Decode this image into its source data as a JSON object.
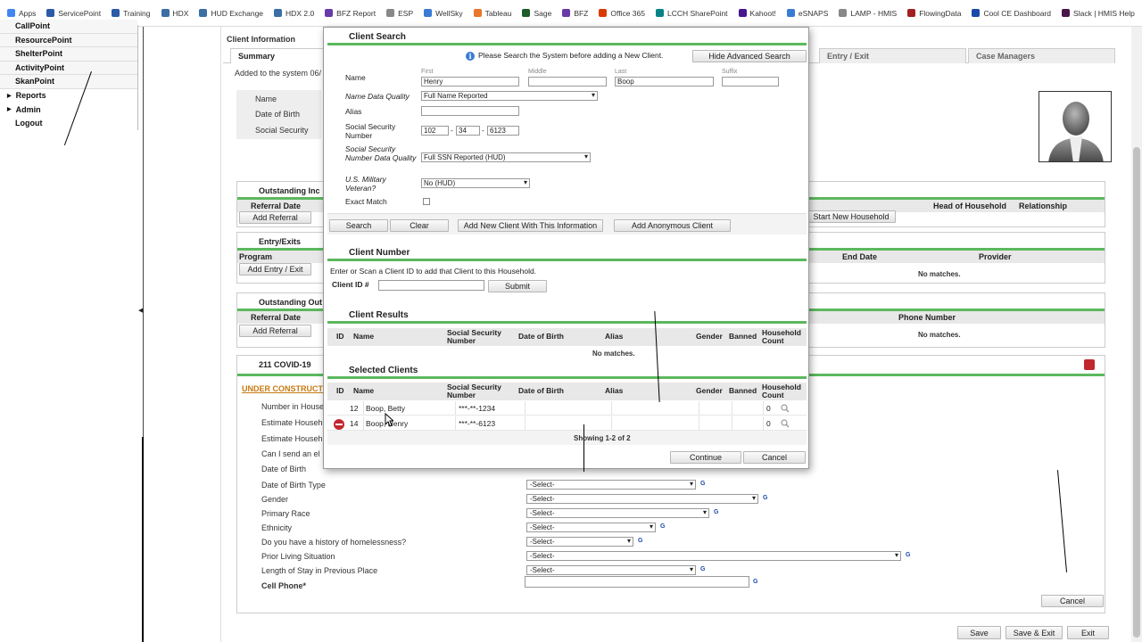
{
  "bookmarks": [
    {
      "label": "Apps",
      "icon": "apps-grid-icon",
      "color": "#4285f4"
    },
    {
      "label": "ServicePoint",
      "icon": "servicepoint-icon",
      "color": "#2b5aa8"
    },
    {
      "label": "Training",
      "icon": "servicepoint-icon",
      "color": "#2b5aa8"
    },
    {
      "label": "HDX",
      "icon": "hdx-icon",
      "color": "#3a6ea5"
    },
    {
      "label": "HUD Exchange",
      "icon": "hud-icon",
      "color": "#3a6ea5"
    },
    {
      "label": "HDX 2.0",
      "icon": "hdx-icon",
      "color": "#3a6ea5"
    },
    {
      "label": "BFZ Report",
      "icon": "bfz-icon",
      "color": "#6a3aa8"
    },
    {
      "label": "ESP",
      "icon": "esp-icon",
      "color": "#888888"
    },
    {
      "label": "WellSky",
      "icon": "wellsky-icon",
      "color": "#3a7bd5"
    },
    {
      "label": "Tableau",
      "icon": "tableau-icon",
      "color": "#e8762b"
    },
    {
      "label": "Sage",
      "icon": "sage-icon",
      "color": "#1e5a2a"
    },
    {
      "label": "BFZ",
      "icon": "bfz-icon",
      "color": "#6a3aa8"
    },
    {
      "label": "Office 365",
      "icon": "office-icon",
      "color": "#d83b01"
    },
    {
      "label": "LCCH SharePoint",
      "icon": "sharepoint-icon",
      "color": "#038387"
    },
    {
      "label": "Kahoot!",
      "icon": "kahoot-icon",
      "color": "#46178f"
    },
    {
      "label": "eSNAPS",
      "icon": "esnaps-icon",
      "color": "#3a7bd5"
    },
    {
      "label": "LAMP - HMIS",
      "icon": "lamp-icon",
      "color": "#888888"
    },
    {
      "label": "FlowingData",
      "icon": "flowingdata-icon",
      "color": "#a32020"
    },
    {
      "label": "Cool CE Dashboard",
      "icon": "dashboard-icon",
      "color": "#1a4aa8"
    },
    {
      "label": "Slack | HMIS Help",
      "icon": "slack-icon",
      "color": "#4a154b"
    }
  ],
  "bookmarks_more": "»",
  "leftnav": {
    "items": [
      {
        "label": "CallPoint",
        "expandable": false
      },
      {
        "label": "ResourcePoint",
        "expandable": false
      },
      {
        "label": "ShelterPoint",
        "expandable": false
      },
      {
        "label": "ActivityPoint",
        "expandable": false
      },
      {
        "label": "SkanPoint",
        "expandable": false
      },
      {
        "label": "Reports",
        "expandable": true
      },
      {
        "label": "Admin",
        "expandable": true
      },
      {
        "label": "Logout",
        "expandable": false
      }
    ]
  },
  "background": {
    "header": "Client Information",
    "tabs": [
      "Summary",
      "Entry / Exit",
      "Case Managers"
    ],
    "added_text": "Added to the system 06/",
    "summary_labels": [
      "Name",
      "Date of Birth",
      "Social Security"
    ],
    "outstanding_incoming": {
      "title": "Outstanding Inc",
      "col": "Referral Date",
      "button": "Add Referral",
      "start_button": "Start New Household",
      "col_head": "Head of Household",
      "col_rel": "Relationship"
    },
    "entry_exits": {
      "title": "Entry/Exits",
      "col": "Program",
      "button": "Add Entry / Exit",
      "col_end": "End Date",
      "col_provider": "Provider",
      "nomatch": "No matches."
    },
    "outstanding_outgoing": {
      "title": "Outstanding Out",
      "col": "Referral Date",
      "button": "Add Referral",
      "col_phone": "Phone Number",
      "nomatch": "No matches."
    },
    "assessment": {
      "title": "211 COVID-19",
      "construction": "UNDER CONSTRUCT",
      "labels": [
        "Number in House",
        "Estimate Househ",
        "Estimate Househ",
        "Can I send an el",
        "Date of Birth",
        "Date of Birth Type",
        "Gender",
        "Primary Race",
        "Ethnicity",
        "Do you have a history of homelessness?",
        "Prior Living Situation",
        "Length of Stay in Previous Place",
        "Cell Phone*"
      ],
      "select_value": "-Select-",
      "g_mark": "G",
      "cancel": "Cancel"
    },
    "footer_buttons": {
      "save": "Save",
      "save_exit": "Save & Exit",
      "exit": "Exit"
    }
  },
  "modal": {
    "client_search": {
      "title": "Client Search",
      "info_text": "Please Search the System before adding a New Client.",
      "hide_advanced": "Hide Advanced Search",
      "name_label": "Name",
      "sublabels": {
        "first": "First",
        "middle": "Middle",
        "last": "Last",
        "suffix": "Suffix"
      },
      "first": "Henry",
      "middle": "",
      "last": "Boop",
      "suffix": "",
      "name_quality_label": "Name Data Quality",
      "name_quality": "Full Name Reported",
      "alias_label": "Alias",
      "alias": "",
      "ssn_label": "Social Security Number",
      "ssn": [
        "102",
        "34",
        "6123"
      ],
      "ssn_dash": "-",
      "ssn_quality_label": "Social Security Number Data Quality",
      "ssn_quality": "Full SSN Reported (HUD)",
      "veteran_label": "U.S. Military Veteran?",
      "veteran": "No (HUD)",
      "exact_match_label": "Exact Match",
      "buttons": {
        "search": "Search",
        "clear": "Clear",
        "add_new": "Add New Client With This Information",
        "add_anon": "Add Anonymous Client"
      }
    },
    "client_number": {
      "title": "Client Number",
      "instructions": "Enter or Scan a Client ID to add that Client to this Household.",
      "label": "Client ID #",
      "value": "",
      "submit": "Submit"
    },
    "client_results": {
      "title": "Client Results",
      "columns": [
        "ID",
        "Name",
        "Social Security Number",
        "Date of Birth",
        "Alias",
        "Gender",
        "Banned",
        "Household Count"
      ],
      "nomatch": "No matches."
    },
    "selected_clients": {
      "title": "Selected Clients",
      "columns": [
        "ID",
        "Name",
        "Social Security Number",
        "Date of Birth",
        "Alias",
        "Gender",
        "Banned",
        "Household Count"
      ],
      "rows": [
        {
          "id": "12",
          "name": "Boop, Betty",
          "ssn": "***-**-1234",
          "dob": "",
          "alias": "",
          "gender": "",
          "banned": "",
          "count": "0"
        },
        {
          "id": "14",
          "name": "Boop, Henry",
          "ssn": "***-**-6123",
          "dob": "",
          "alias": "",
          "gender": "",
          "banned": "",
          "count": "0"
        }
      ],
      "showing": "Showing 1-2 of 2"
    },
    "buttons": {
      "continue": "Continue",
      "cancel": "Cancel"
    }
  },
  "colors": {
    "accent_green": "#5cb85c",
    "header_gray": "#e8e8e8",
    "remove_red": "#c1272d",
    "link_orange": "#c67a12"
  }
}
